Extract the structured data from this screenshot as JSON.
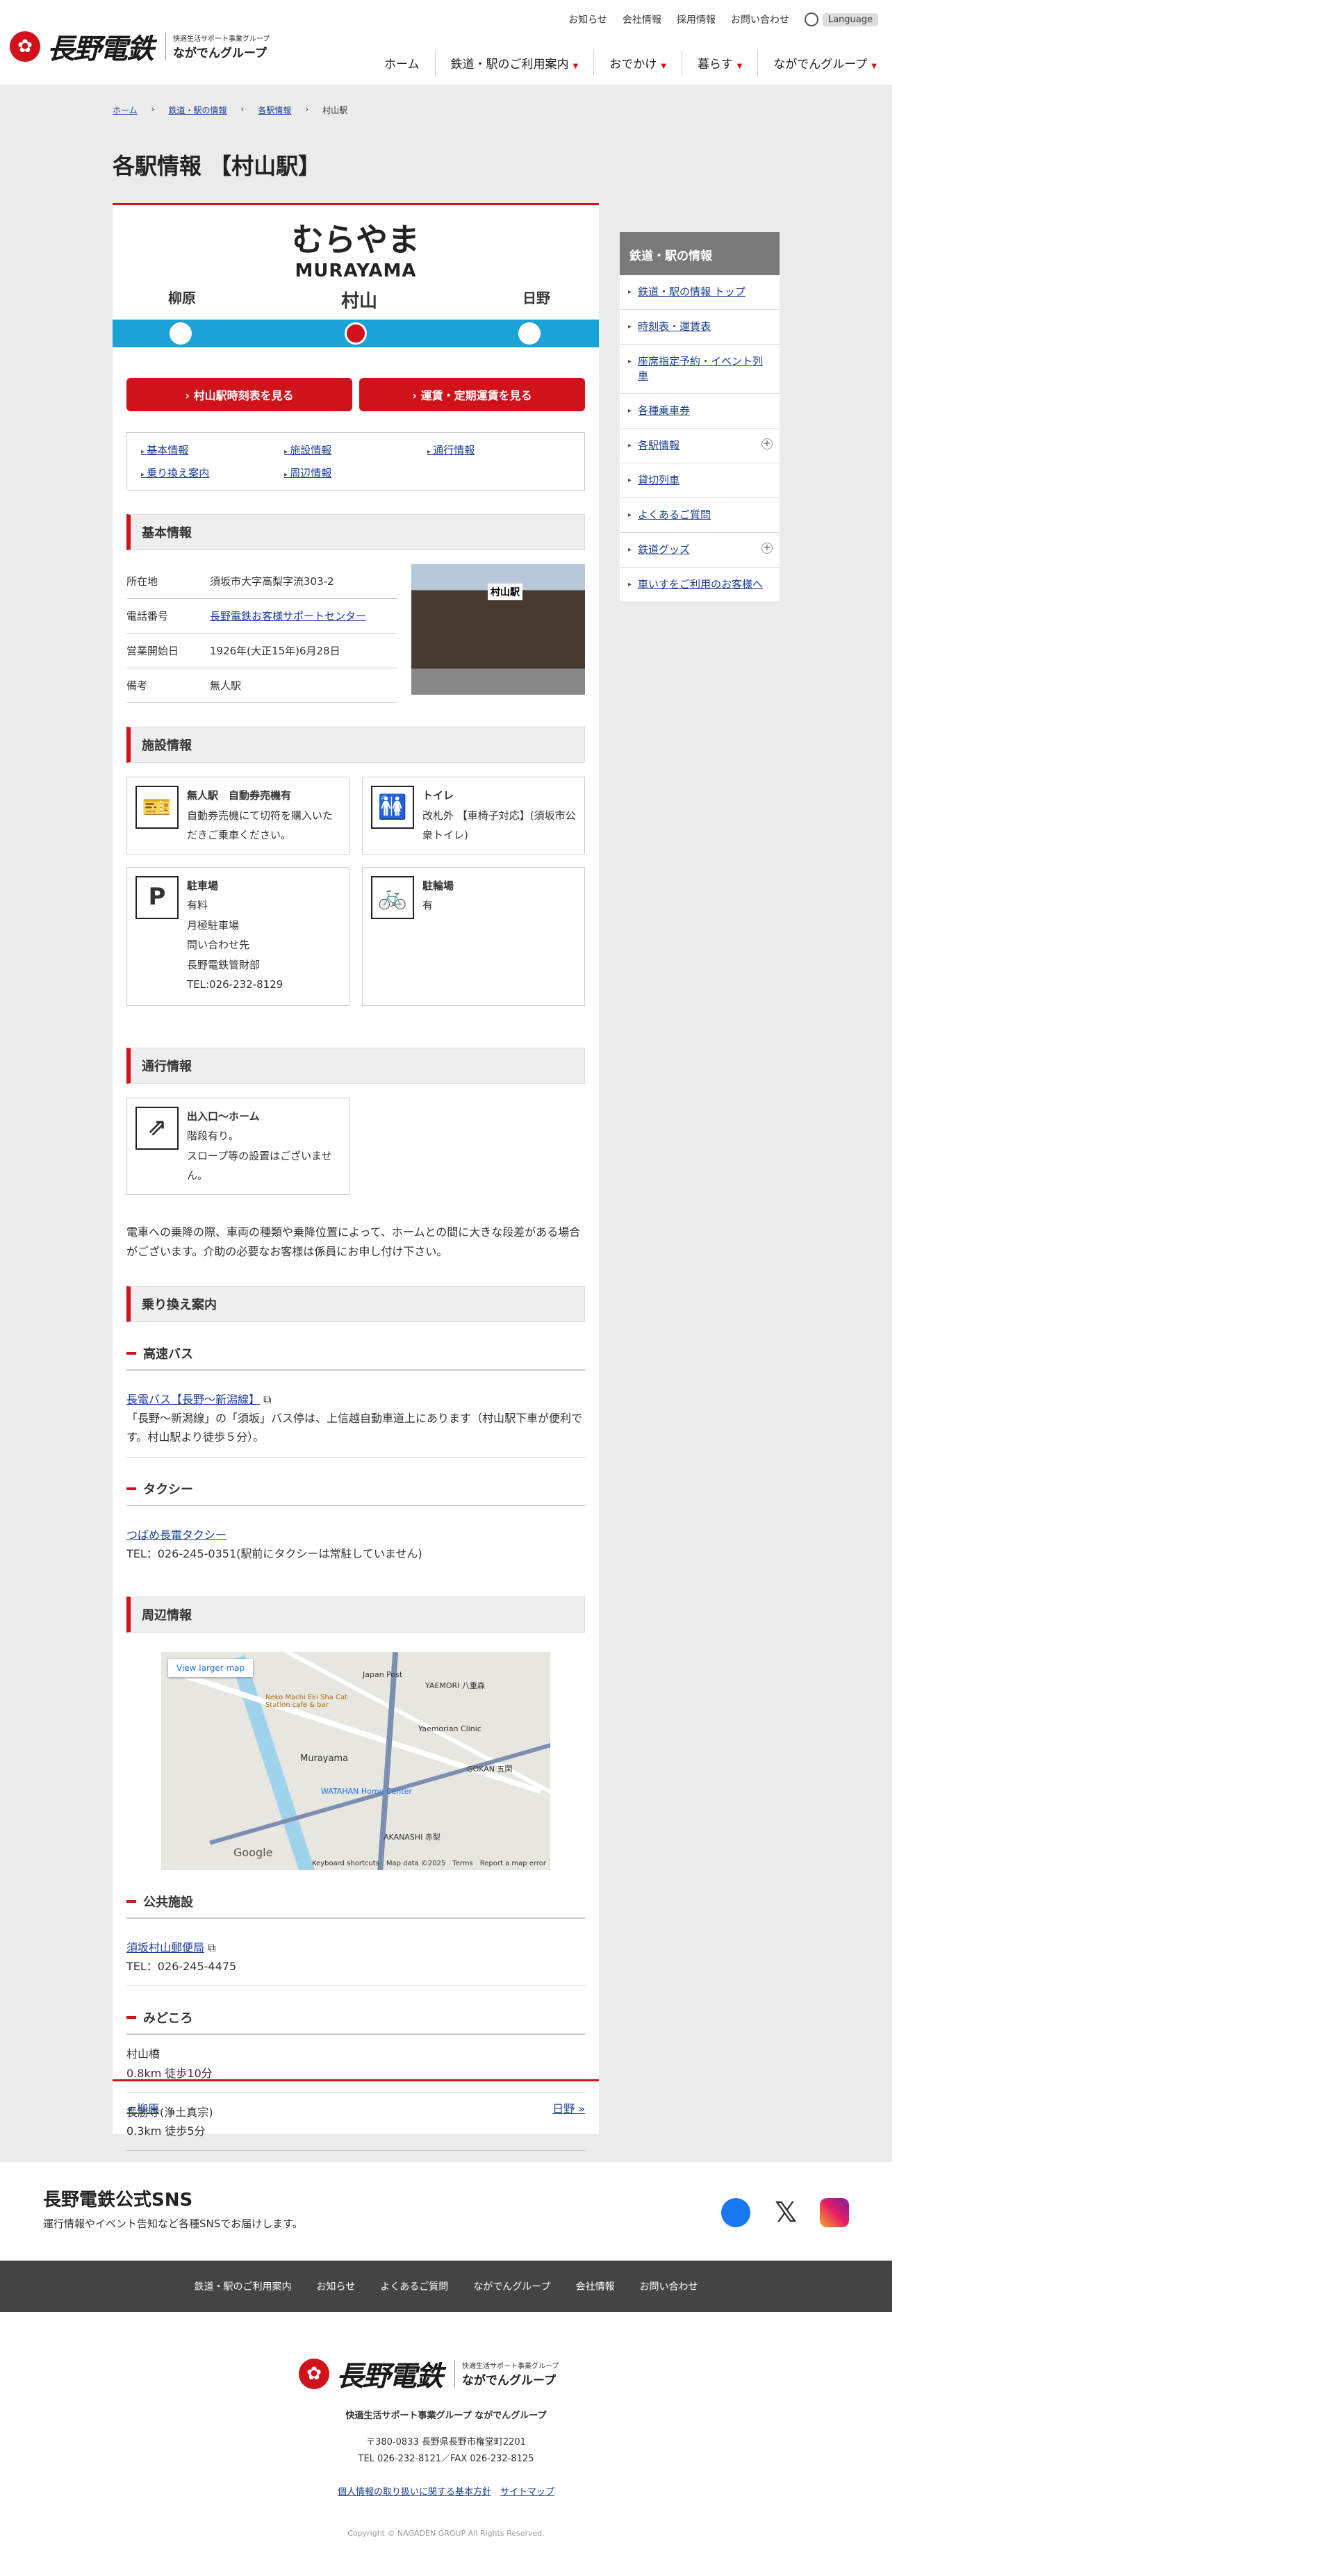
{
  "header": {
    "logo_text": "長野電鉄",
    "group_small": "快適生活サポート事業グループ",
    "group_name": "ながでんグループ",
    "util": [
      "お知らせ",
      "会社情報",
      "採用情報",
      "お問い合わせ"
    ],
    "language": "Language",
    "nav": [
      "ホーム",
      "鉄道・駅のご利用案内",
      "おでかけ",
      "暮らす",
      "ながでんグループ"
    ]
  },
  "breadcrumb": [
    "ホーム",
    "鉄道・駅の情報",
    "各駅情報",
    "村山駅"
  ],
  "page_title": "各駅情報 【村山駅】",
  "station": {
    "kana": "むらやま",
    "roman": "MURAYAMA",
    "prev": "柳原",
    "current": "村山",
    "next": "日野"
  },
  "buttons": {
    "timetable": "村山駅時刻表を見る",
    "fare": "運賃・定期運賃を見る"
  },
  "anchors": [
    "基本情報",
    "施設情報",
    "通行情報",
    "乗り換え案内",
    "周辺情報"
  ],
  "basic": {
    "heading": "基本情報",
    "rows": [
      {
        "k": "所在地",
        "v": "須坂市大字高梨字流303-2"
      },
      {
        "k": "電話番号",
        "v": "長野電鉄お客様サポートセンター"
      },
      {
        "k": "営業開始日",
        "v": "1926年(大正15年)6月28日"
      },
      {
        "k": "備考",
        "v": "無人駅"
      }
    ],
    "photo_sign": "村山駅"
  },
  "facility": {
    "heading": "施設情報",
    "items": [
      {
        "icon": "ticket-machine-icon",
        "glyph": "🎫",
        "title": "無人駅　自動券売機有",
        "text": "自動券売機にて切符を購入いただきご乗車ください。"
      },
      {
        "icon": "toilet-icon",
        "glyph": "🚻",
        "title": "トイレ",
        "text": "改札外 【車椅子対応】(須坂市公衆トイレ)"
      },
      {
        "icon": "parking-icon",
        "glyph": "P",
        "title": "駐車場",
        "text": "有料\n月極駐車場\n問い合わせ先\n長野電鉄管財部\nTEL:026-232-8129"
      },
      {
        "icon": "bicycle-icon",
        "glyph": "🚲",
        "title": "駐輪場",
        "text": "有"
      }
    ]
  },
  "access": {
    "heading": "通行情報",
    "title": "出入口〜ホーム",
    "text": "階段有り。\nスロープ等の設置はございません。",
    "note": "電車への乗降の際、車両の種類や乗降位置によって、ホームとの間に大きな段差がある場合がございます。介助の必要なお客様は係員にお申し付け下さい。"
  },
  "transfer": {
    "heading": "乗り換え案内",
    "bus_h": "高速バス",
    "bus_link": "長電バス【長野〜新潟線】",
    "bus_text": "「長野〜新潟線」の「須坂」バス停は、上信越自動車道上にあります（村山駅下車が便利です。村山駅より徒歩５分）。",
    "taxi_h": "タクシー",
    "taxi_link": "つばめ長電タクシー",
    "taxi_text": "TEL：026-245-0351(駅前にタクシーは常駐していません)"
  },
  "nearby": {
    "heading": "周辺情報",
    "map_link": "View larger map",
    "map_labels": [
      "Murayama",
      "Japan Post",
      "YAEMORI 八重森",
      "GOKAN 五閑",
      "AKANASHI 赤梨",
      "WATAHAN Home Center",
      "Neko Machi Eki Sha Cat Station cafe & bar",
      "Yaemorian Clinic"
    ],
    "map_footer": [
      "Keyboard shortcuts",
      "Map data ©2025",
      "Terms",
      "Report a map error"
    ],
    "google": "Google",
    "public_h": "公共施設",
    "public_link": "須坂村山郵便局",
    "public_tel": "TEL：026-245-4475",
    "sights_h": "みどころ",
    "sights": [
      {
        "name": "村山橋",
        "dist": "0.8km 徒歩10分"
      },
      {
        "name": "長勝寺(浄土真宗)",
        "dist": "0.3km 徒歩5分"
      }
    ]
  },
  "prev_link": "« 柳原",
  "next_link": "日野 »",
  "sidebar": {
    "title": "鉄道・駅の情報",
    "items": [
      {
        "label": "鉄道・駅の情報 トップ",
        "plus": false
      },
      {
        "label": "時刻表・運賃表",
        "plus": false
      },
      {
        "label": "座席指定予約・イベント列車",
        "plus": false
      },
      {
        "label": "各種乗車券",
        "plus": false
      },
      {
        "label": "各駅情報",
        "plus": true
      },
      {
        "label": "貸切列車",
        "plus": false
      },
      {
        "label": "よくあるご質問",
        "plus": false
      },
      {
        "label": "鉄道グッズ",
        "plus": true
      },
      {
        "label": "車いすをご利用のお客様へ",
        "plus": false
      }
    ]
  },
  "sns": {
    "title": "長野電鉄公式SNS",
    "text": "運行情報やイベント告知など各種SNSでお届けします。"
  },
  "footer_nav": [
    "鉄道・駅のご利用案内",
    "お知らせ",
    "よくあるご質問",
    "ながでんグループ",
    "会社情報",
    "お問い合わせ"
  ],
  "footer": {
    "group": "快適生活サポート事業グループ ながでんグループ",
    "address": "〒380-0833 長野県長野市権堂町2201",
    "tel": "TEL 026-232-8121／FAX 026-232-8125",
    "privacy": "個人情報の取り扱いに関する基本方針",
    "sitemap": "サイトマップ",
    "copyright": "Copyright © NAGADEN GROUP All Rights Reserved."
  },
  "colors": {
    "accent": "#d0121b",
    "line": "#1ba3d8"
  }
}
